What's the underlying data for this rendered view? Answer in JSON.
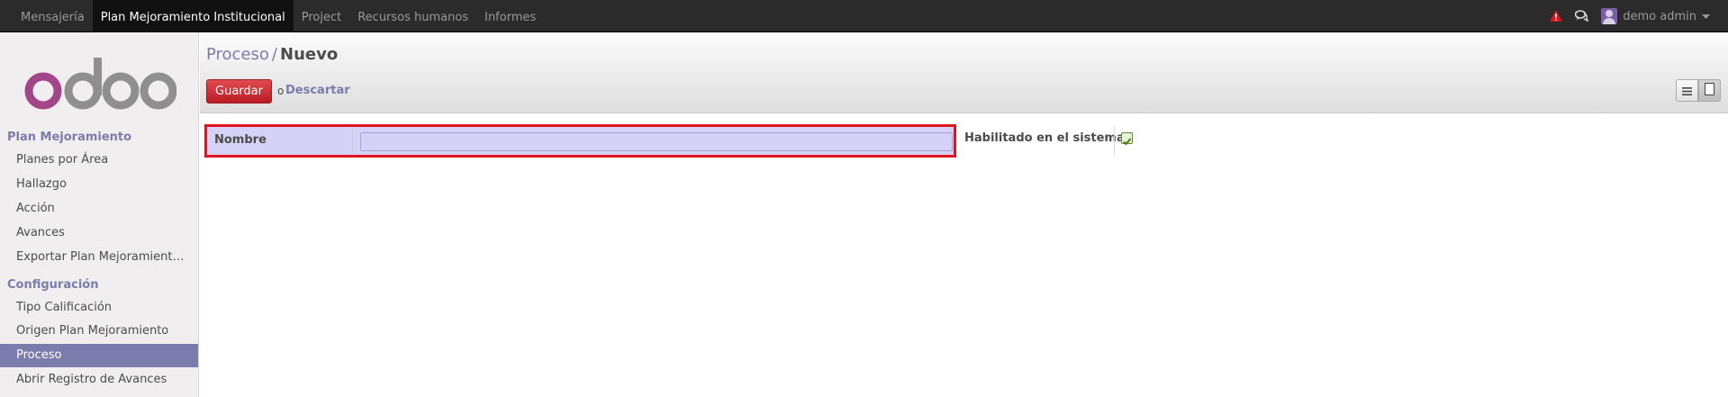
{
  "topbar": {
    "menu": [
      {
        "label": "Mensajería",
        "active": false
      },
      {
        "label": "Plan Mejoramiento Institucional",
        "active": true
      },
      {
        "label": "Project",
        "active": false
      },
      {
        "label": "Recursos humanos",
        "active": false
      },
      {
        "label": "Informes",
        "active": false
      }
    ],
    "user": "demo  admin"
  },
  "sidebar": {
    "sections": [
      {
        "title": "Plan Mejoramiento",
        "items": [
          "Planes por Área",
          "Hallazgo",
          "Acción",
          "Avances",
          "Exportar Plan Mejoramient…"
        ]
      },
      {
        "title": "Configuración",
        "items": [
          "Tipo Calificación",
          "Origen Plan Mejoramiento",
          "Proceso",
          "Abrir Registro de Avances"
        ]
      }
    ],
    "active_item": "Proceso"
  },
  "header": {
    "breadcrumb_parent": "Proceso",
    "breadcrumb_sep": "/",
    "breadcrumb_current": "Nuevo",
    "save_label": "Guardar",
    "or_label": "o",
    "discard_label": "Descartar"
  },
  "form": {
    "name_label": "Nombre",
    "name_value": "",
    "enabled_label": "Habilitado en el sistema?",
    "enabled_checked": true
  },
  "colors": {
    "accent": "#7c7bad",
    "save_button": "#dc2e35",
    "highlight_border": "#e0141e",
    "required_field_bg": "#d6d2f7"
  }
}
